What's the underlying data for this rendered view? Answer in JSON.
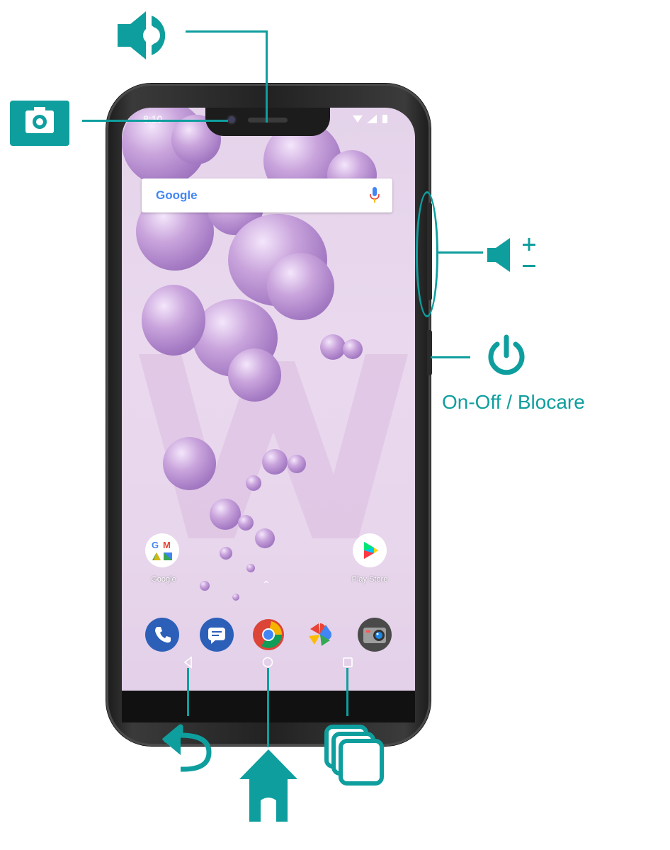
{
  "colors": {
    "accent": "#0f9e9e",
    "screen_background": "#e8d6ec",
    "phone_frame": "#222222"
  },
  "phone": {
    "status_bar": {
      "time": "8:10"
    },
    "search_widget": {
      "logo": "Google",
      "mic_icon": "mic-icon"
    },
    "home_apps": [
      {
        "label": "Google",
        "icon": "google-folder-icon"
      },
      {
        "label": "Play Store",
        "icon": "play-store-icon"
      }
    ],
    "dock_apps": [
      {
        "icon": "phone-icon"
      },
      {
        "icon": "messages-icon"
      },
      {
        "icon": "chrome-icon"
      },
      {
        "icon": "photos-icon"
      },
      {
        "icon": "camera-app-icon"
      }
    ],
    "nav_buttons": [
      {
        "icon": "back-icon"
      },
      {
        "icon": "home-circle-icon"
      },
      {
        "icon": "recents-square-icon"
      }
    ]
  },
  "callouts": {
    "speaker": {
      "icon": "speaker-icon"
    },
    "front_camera": {
      "icon": "camera-icon"
    },
    "volume": {
      "icon": "volume-plus-minus-icon"
    },
    "power": {
      "icon": "power-icon",
      "caption": "On-Off / Blocare"
    },
    "back": {
      "icon": "back-arrow-icon"
    },
    "home": {
      "icon": "home-icon"
    },
    "recents": {
      "icon": "recent-apps-icon"
    }
  }
}
